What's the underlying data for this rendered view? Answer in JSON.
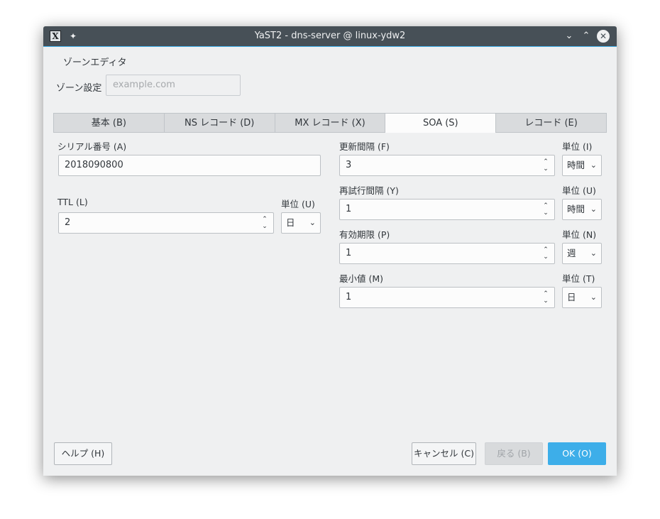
{
  "window": {
    "title": "YaST2 - dns-server @ linux-ydw2",
    "icons": {
      "app": "yast-x-icon",
      "pin": "pin-icon",
      "minimize": "chevron-down-icon",
      "maximize": "chevron-up-icon",
      "close": "close-icon"
    }
  },
  "section_title": "ゾーンエディタ",
  "zone": {
    "label": "ゾーン設定",
    "placeholder": "example.com"
  },
  "tabs": [
    {
      "label": "基本 (B)"
    },
    {
      "label": "NS レコード (D)"
    },
    {
      "label": "MX レコード (X)"
    },
    {
      "label": "SOA (S)"
    },
    {
      "label": "レコード (E)"
    }
  ],
  "active_tab": "SOA (S)",
  "soa": {
    "serial": {
      "label": "シリアル番号 (A)",
      "value": "2018090800"
    },
    "ttl": {
      "label": "TTL (L)",
      "value": "2",
      "unit_label": "単位 (U)",
      "unit": "日"
    },
    "refresh": {
      "label": "更新間隔 (F)",
      "value": "3",
      "unit_label": "単位 (I)",
      "unit": "時間"
    },
    "retry": {
      "label": "再試行間隔 (Y)",
      "value": "1",
      "unit_label": "単位 (U)",
      "unit": "時間"
    },
    "expire": {
      "label": "有効期限 (P)",
      "value": "1",
      "unit_label": "単位 (N)",
      "unit": "週"
    },
    "minimum": {
      "label": "最小値 (M)",
      "value": "1",
      "unit_label": "単位 (T)",
      "unit": "日"
    }
  },
  "buttons": {
    "help": "ヘルプ (H)",
    "cancel": "キャンセル (C)",
    "back": "戻る (B)",
    "ok": "OK (O)"
  },
  "colors": {
    "titlebar": "#475057",
    "accent": "#3daee9",
    "window_bg": "#eff0f1"
  }
}
